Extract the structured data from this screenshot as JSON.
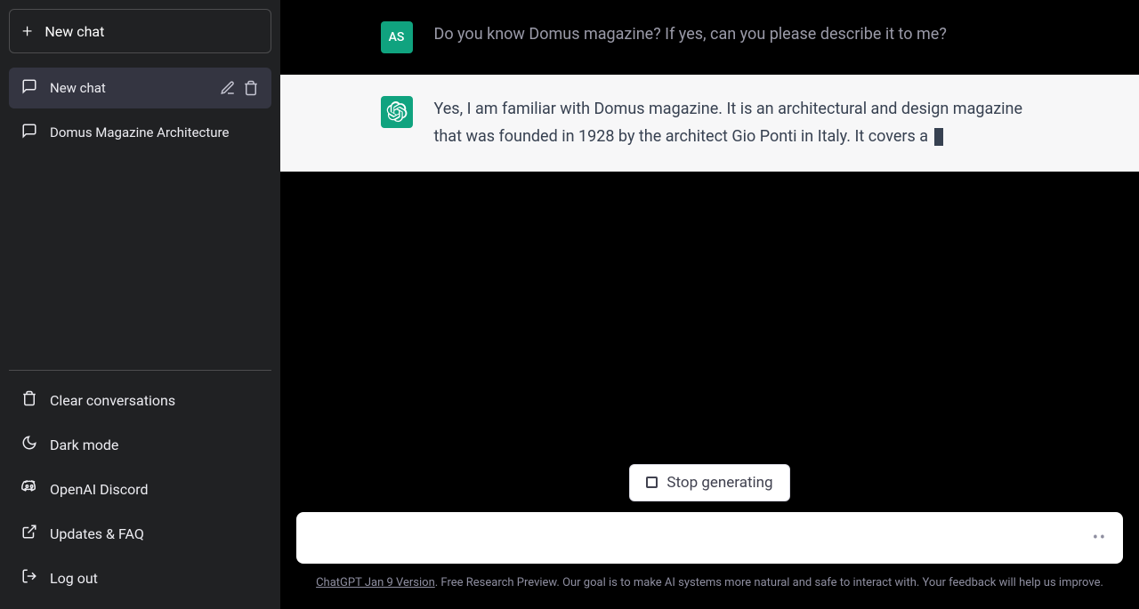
{
  "sidebar": {
    "new_chat_label": "New chat",
    "chats": [
      {
        "label": "New chat",
        "active": true
      },
      {
        "label": "Domus Magazine Architecture",
        "active": false
      }
    ],
    "footer": {
      "clear": "Clear conversations",
      "dark_mode": "Dark mode",
      "discord": "OpenAI Discord",
      "faq": "Updates & FAQ",
      "logout": "Log out"
    }
  },
  "conversation": {
    "user_avatar": "AS",
    "user_message": "Do you know Domus magazine? If yes, can you please describe it to me?",
    "assistant_message": "Yes, I am familiar with Domus magazine. It is an architectural and design magazine that was founded in 1928 by the architect Gio Ponti in Italy. It covers a "
  },
  "controls": {
    "stop_label": "Stop generating",
    "input_value": ""
  },
  "disclaimer": {
    "version_link": "ChatGPT Jan 9 Version",
    "text": ". Free Research Preview. Our goal is to make AI systems more natural and safe to interact with. Your feedback will help us improve."
  }
}
